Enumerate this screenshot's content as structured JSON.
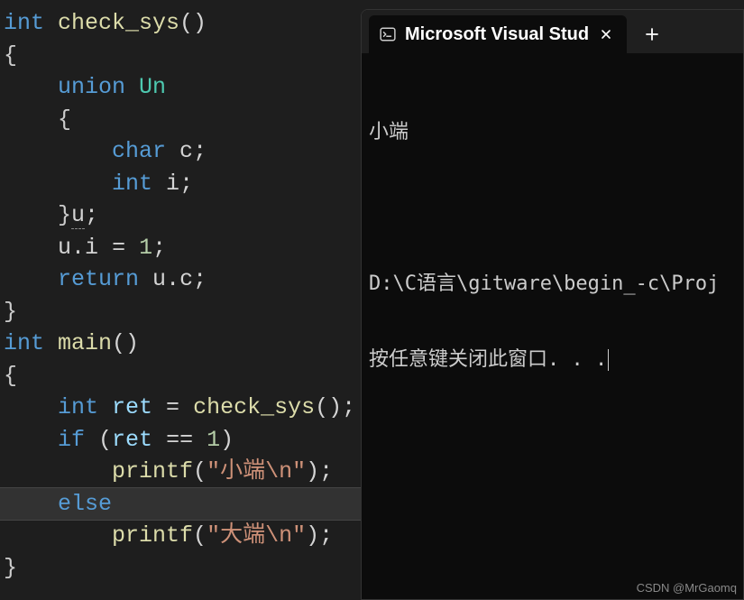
{
  "code": {
    "lines": [
      {
        "segments": [
          {
            "t": "int ",
            "c": "tok-type"
          },
          {
            "t": "check_sys",
            "c": "tok-func"
          },
          {
            "t": "()",
            "c": "tok-punct"
          }
        ],
        "indent": 0
      },
      {
        "segments": [
          {
            "t": "{",
            "c": "tok-brace"
          }
        ],
        "indent": 0
      },
      {
        "segments": [
          {
            "t": "union ",
            "c": "tok-keyword"
          },
          {
            "t": "Un",
            "c": "tok-union"
          }
        ],
        "indent": 1
      },
      {
        "segments": [
          {
            "t": "{",
            "c": "tok-brace"
          }
        ],
        "indent": 1
      },
      {
        "segments": [
          {
            "t": "char ",
            "c": "tok-type"
          },
          {
            "t": "c",
            "c": "tok-var"
          },
          {
            "t": ";",
            "c": "tok-punct"
          }
        ],
        "indent": 2
      },
      {
        "segments": [
          {
            "t": "int ",
            "c": "tok-type"
          },
          {
            "t": "i",
            "c": "tok-var"
          },
          {
            "t": ";",
            "c": "tok-punct"
          }
        ],
        "indent": 2
      },
      {
        "segments": [
          {
            "t": "}",
            "c": "tok-brace"
          },
          {
            "t": "u",
            "c": "tok-var tok-underline"
          },
          {
            "t": ";",
            "c": "tok-punct"
          }
        ],
        "indent": 1
      },
      {
        "segments": [
          {
            "t": "u",
            "c": "tok-var"
          },
          {
            "t": ".",
            "c": "tok-punct"
          },
          {
            "t": "i",
            "c": "tok-var"
          },
          {
            "t": " = ",
            "c": "tok-punct"
          },
          {
            "t": "1",
            "c": "tok-num"
          },
          {
            "t": ";",
            "c": "tok-punct"
          }
        ],
        "indent": 1
      },
      {
        "segments": [
          {
            "t": "return ",
            "c": "tok-keyword"
          },
          {
            "t": "u",
            "c": "tok-var"
          },
          {
            "t": ".",
            "c": "tok-punct"
          },
          {
            "t": "c",
            "c": "tok-var"
          },
          {
            "t": ";",
            "c": "tok-punct"
          }
        ],
        "indent": 1
      },
      {
        "segments": [
          {
            "t": "}",
            "c": "tok-brace"
          }
        ],
        "indent": 0
      },
      {
        "segments": [
          {
            "t": "int ",
            "c": "tok-type"
          },
          {
            "t": "main",
            "c": "tok-func"
          },
          {
            "t": "()",
            "c": "tok-punct"
          }
        ],
        "indent": 0
      },
      {
        "segments": [
          {
            "t": "{",
            "c": "tok-brace"
          }
        ],
        "indent": 0
      },
      {
        "segments": [
          {
            "t": "int ",
            "c": "tok-type"
          },
          {
            "t": "ret",
            "c": "tok-ident"
          },
          {
            "t": " = ",
            "c": "tok-punct"
          },
          {
            "t": "check_sys",
            "c": "tok-func"
          },
          {
            "t": "();",
            "c": "tok-punct"
          }
        ],
        "indent": 1
      },
      {
        "segments": [
          {
            "t": "if ",
            "c": "tok-keyword"
          },
          {
            "t": "(",
            "c": "tok-punct"
          },
          {
            "t": "ret",
            "c": "tok-ident"
          },
          {
            "t": " == ",
            "c": "tok-punct"
          },
          {
            "t": "1",
            "c": "tok-num"
          },
          {
            "t": ")",
            "c": "tok-punct"
          }
        ],
        "indent": 1
      },
      {
        "segments": [
          {
            "t": "printf",
            "c": "tok-func"
          },
          {
            "t": "(",
            "c": "tok-punct"
          },
          {
            "t": "\"小端\\n\"",
            "c": "tok-string"
          },
          {
            "t": ");",
            "c": "tok-punct"
          }
        ],
        "indent": 2
      },
      {
        "segments": [
          {
            "t": "else",
            "c": "tok-keyword"
          }
        ],
        "indent": 1,
        "highlighted": true
      },
      {
        "segments": [
          {
            "t": "printf",
            "c": "tok-func"
          },
          {
            "t": "(",
            "c": "tok-punct"
          },
          {
            "t": "\"大端\\n\"",
            "c": "tok-string"
          },
          {
            "t": ");",
            "c": "tok-punct"
          }
        ],
        "indent": 2
      },
      {
        "segments": [
          {
            "t": "}",
            "c": "tok-brace"
          }
        ],
        "indent": 0
      }
    ]
  },
  "terminal": {
    "tab_title": "Microsoft Visual Stud",
    "output_line1": "小端",
    "output_line2": "D:\\C语言\\gitware\\begin_-c\\Proj",
    "output_line3": "按任意键关闭此窗口. . ."
  },
  "watermark": "CSDN @MrGaomq"
}
